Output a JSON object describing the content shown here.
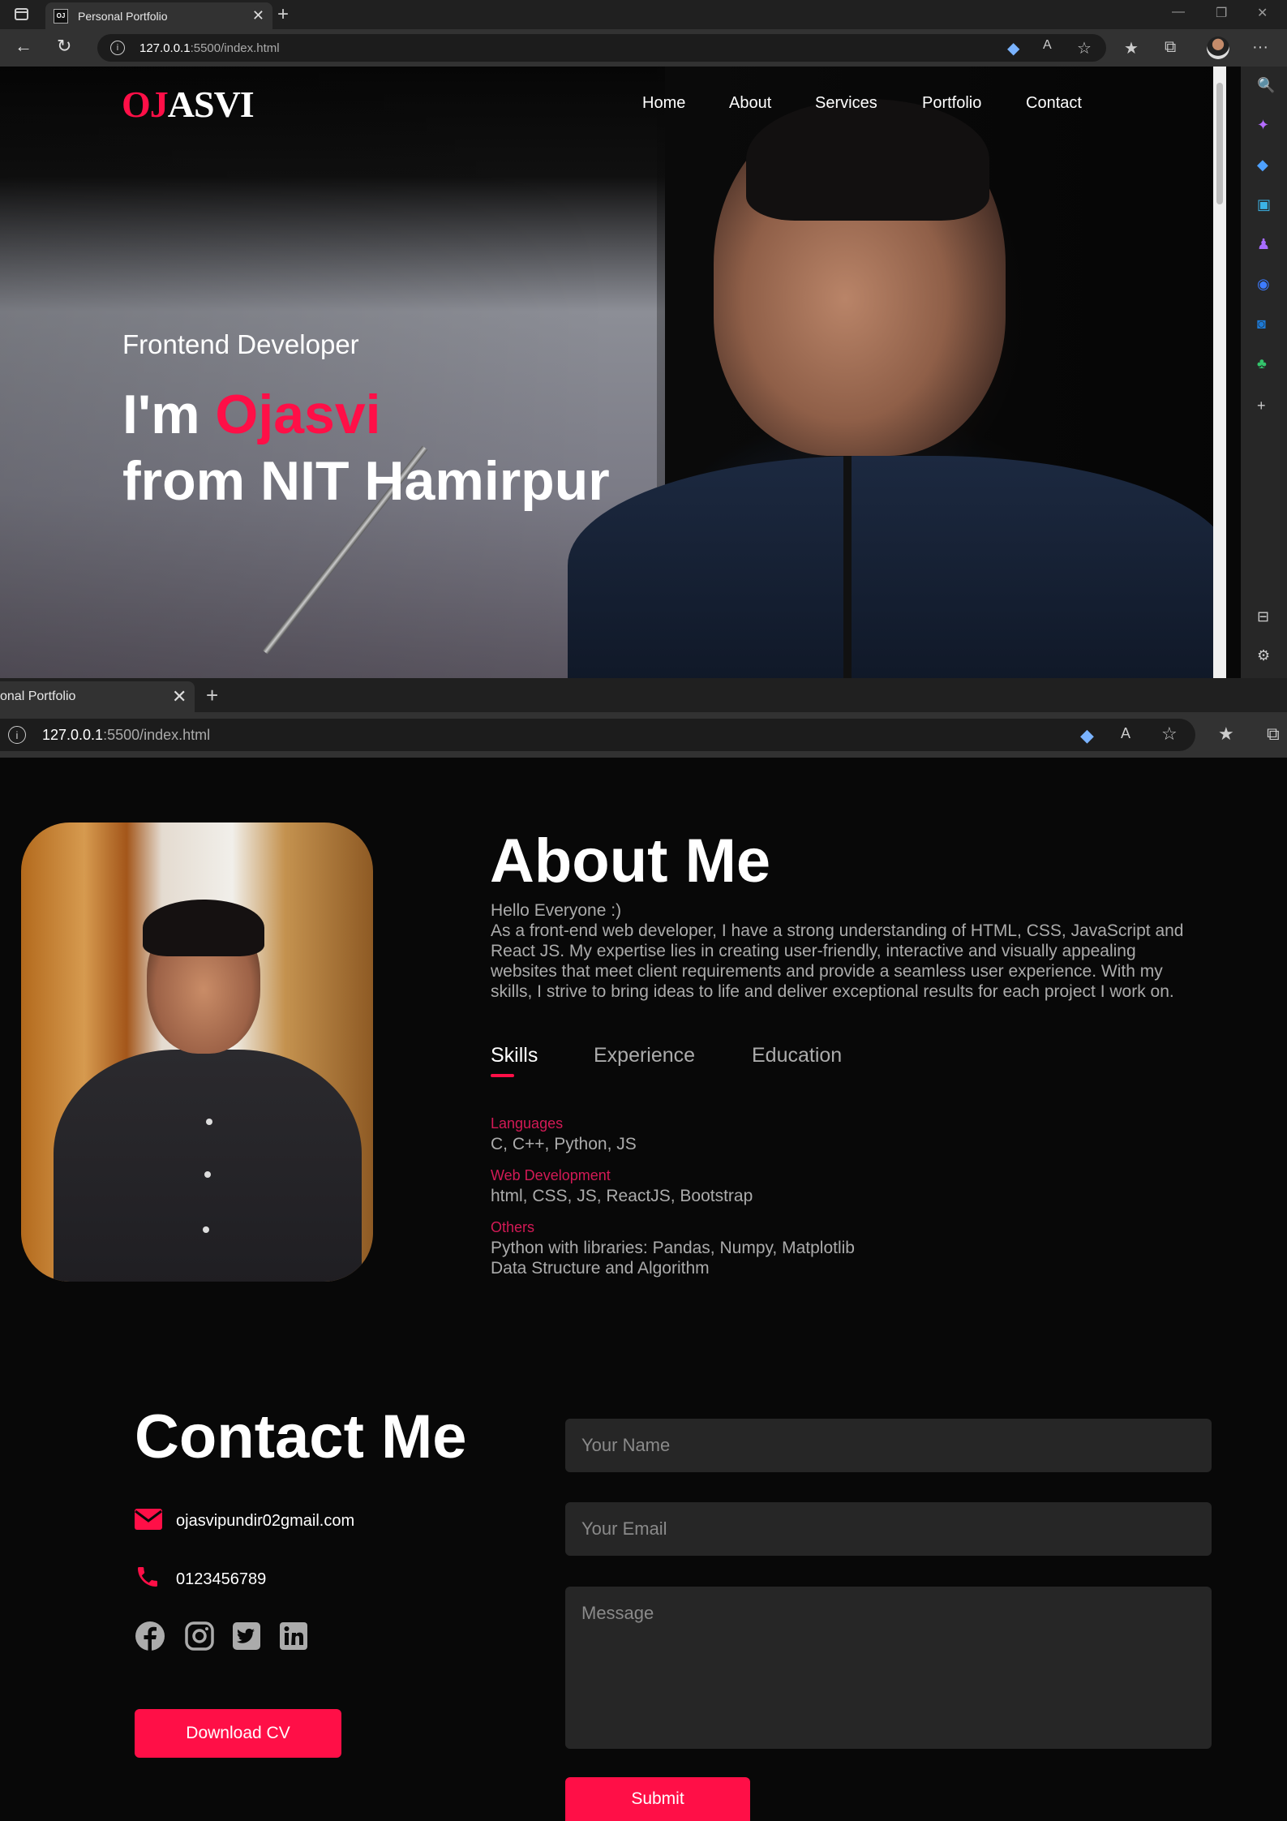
{
  "browser": {
    "tab_title": "Personal Portfolio",
    "tab_title_partial": "onal Portfolio",
    "favicon_text": "OJ",
    "url_host": "127.0.0.1",
    "url_rest": ":5500/index.html"
  },
  "header": {
    "logo_red": "OJ",
    "logo_white": "ASVI",
    "nav": [
      "Home",
      "About",
      "Services",
      "Portfolio",
      "Contact"
    ]
  },
  "hero": {
    "subtitle": "Frontend Developer",
    "greeting": "I'm ",
    "name": "Ojasvi",
    "line2": "from NIT Hamirpur"
  },
  "about": {
    "title": "About Me",
    "greeting": "Hello Everyone :)",
    "paragraph": "As a front-end web developer, I have a strong understanding of HTML, CSS, JavaScript and React JS. My expertise lies in creating user-friendly, interactive and visually appealing websites that meet client requirements and provide a seamless user experience. With my skills, I strive to bring ideas to life and deliver exceptional results for each project I work on.",
    "tabs": [
      "Skills",
      "Experience",
      "Education"
    ],
    "active_tab": "Skills",
    "skills": [
      {
        "heading": "Languages",
        "lines": [
          "C, C++, Python, JS"
        ]
      },
      {
        "heading": "Web Development",
        "lines": [
          "html, CSS, JS, ReactJS, Bootstrap"
        ]
      },
      {
        "heading": "Others",
        "lines": [
          "Python with libraries: Pandas, Numpy, Matplotlib",
          "Data Structure and Algorithm"
        ]
      }
    ]
  },
  "contact": {
    "title": "Contact Me",
    "email": "ojasvipundir02gmail.com",
    "phone": "0123456789",
    "social_icons": [
      "facebook-icon",
      "instagram-icon",
      "twitter-icon",
      "linkedin-icon"
    ],
    "cv_button": "Download CV",
    "form": {
      "name_placeholder": "Your Name",
      "email_placeholder": "Your Email",
      "message_placeholder": "Message",
      "submit": "Submit"
    }
  },
  "colors": {
    "accent": "#ff0f47",
    "background": "#080808",
    "muted_text": "#ababab",
    "field_bg": "#262626"
  }
}
